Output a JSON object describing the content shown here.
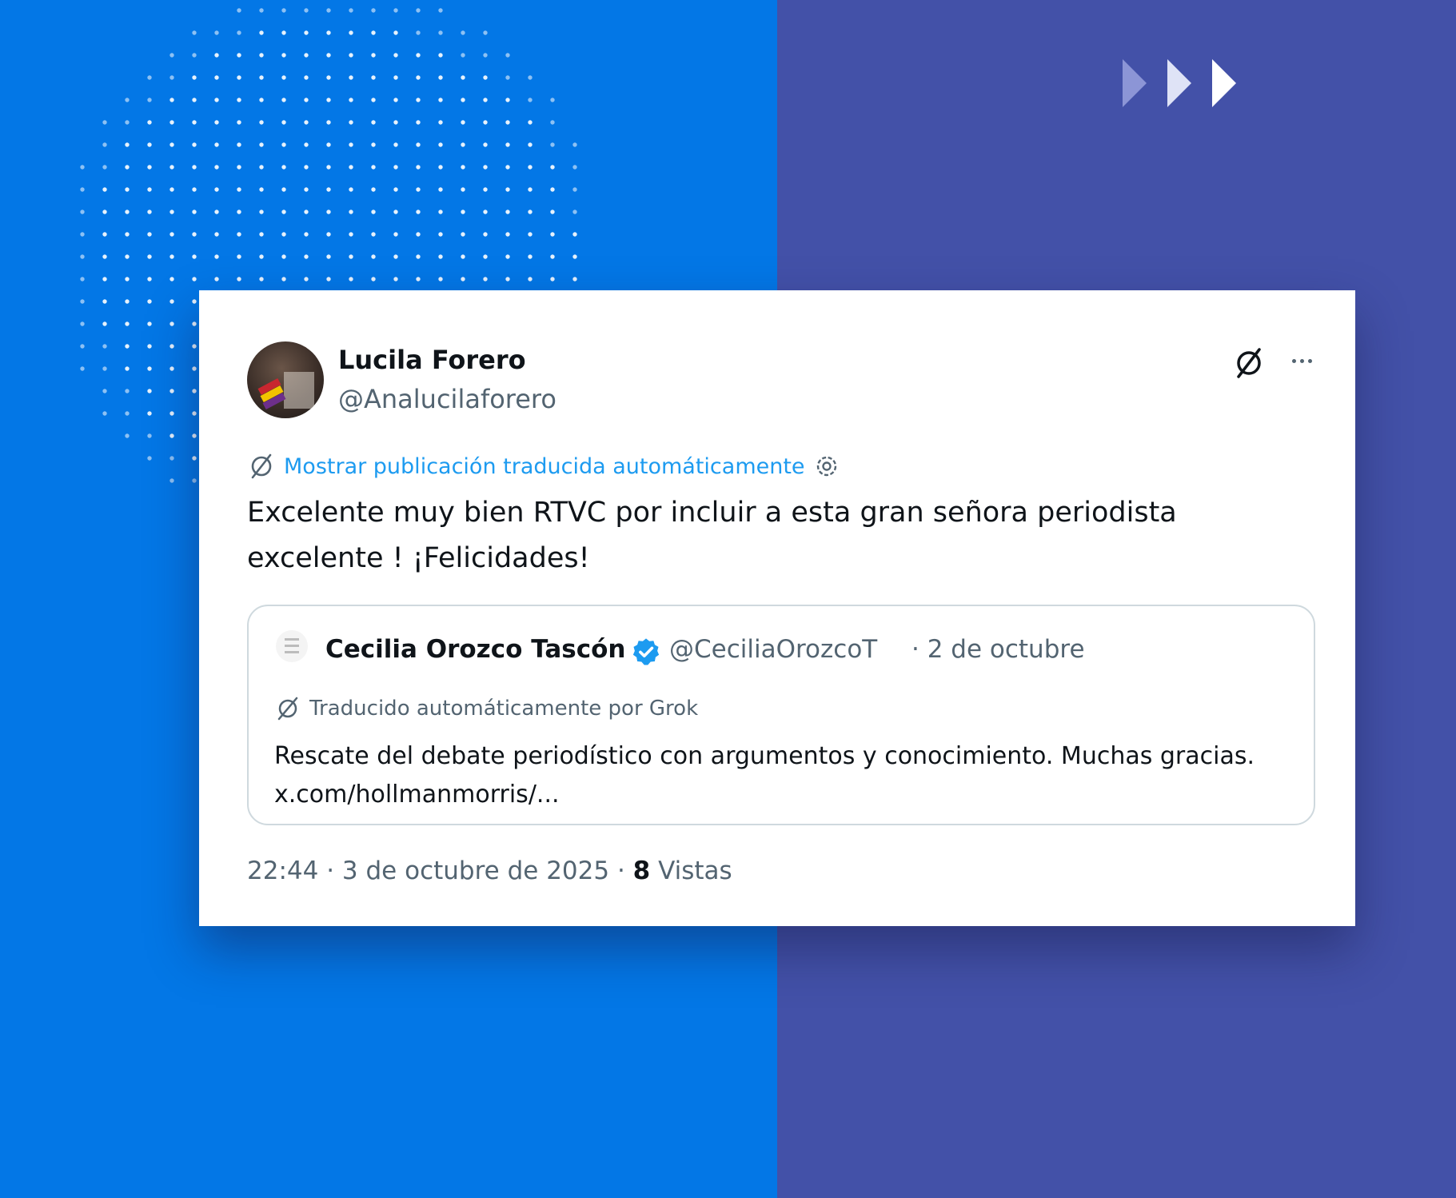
{
  "tweet": {
    "author_name": "Lucila Forero",
    "author_handle": "@Analucilaforero",
    "translate_link": "Mostrar publicación traducida automáticamente",
    "text": "Excelente muy bien RTVC por incluir a esta gran señora periodista excelente ! ¡Felicidades!",
    "time": "22:44",
    "sep1": "·",
    "date": "3 de octubre de 2025",
    "sep2": "·",
    "views_count": "8",
    "views_label": "Vistas"
  },
  "quote": {
    "author_name": "Cecilia Orozco Tascón",
    "author_handle": "@CeciliaOrozcoT",
    "date": "· 2 de octubre",
    "translation_note": "Traducido automáticamente por Grok",
    "text": "Rescate del debate periodístico con argumentos y conocimiento. Muchas gracias. x.com/hollmanmorris/..."
  },
  "icons": {
    "top_right": [
      "grok-icon",
      "more-icon"
    ],
    "verified": "verified-badge-icon",
    "settings": "gear-icon"
  },
  "colors": {
    "left_background": "#0377e6",
    "right_background": "#4351a8",
    "link_blue": "#1d9bf0",
    "text_primary": "#0f1419",
    "text_secondary": "#536471",
    "border": "#cfd9de"
  }
}
